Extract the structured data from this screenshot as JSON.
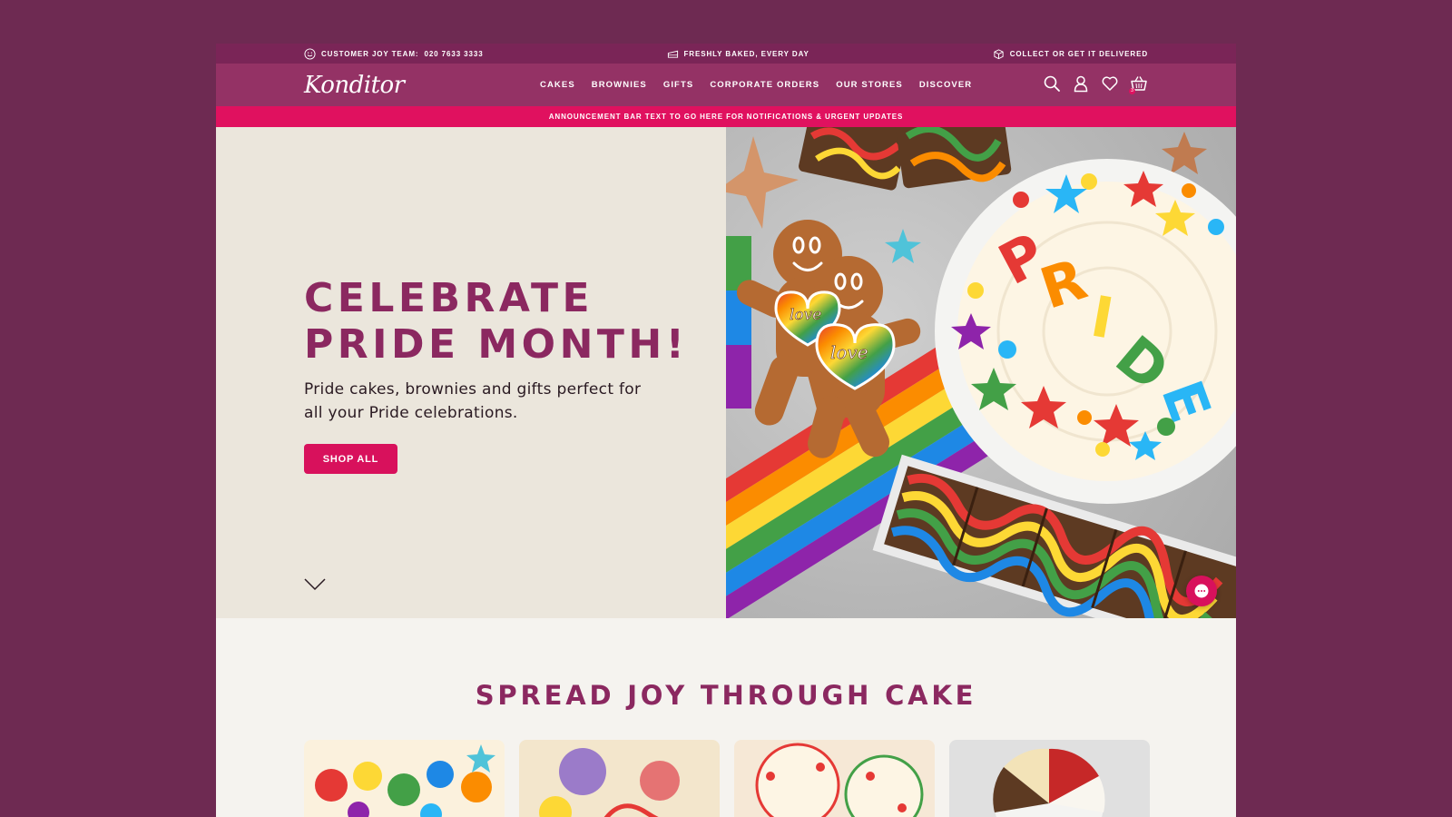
{
  "utility_bar": {
    "customer_team_label": "CUSTOMER JOY TEAM:",
    "phone": "020 7633 3333",
    "fresh_text": "FRESHLY BAKED, EVERY DAY",
    "delivery_text": "COLLECT OR GET IT DELIVERED",
    "icons": [
      "smile-icon",
      "cake-slice-icon",
      "box-icon"
    ]
  },
  "nav": {
    "logo_text": "Konditor",
    "items": [
      {
        "label": "CAKES"
      },
      {
        "label": "BROWNIES"
      },
      {
        "label": "GIFTS"
      },
      {
        "label": "CORPORATE ORDERS"
      },
      {
        "label": "OUR STORES"
      },
      {
        "label": "DISCOVER"
      }
    ],
    "icons": [
      "search-icon",
      "account-icon",
      "wishlist-heart-icon",
      "basket-icon"
    ],
    "cart_count": "3"
  },
  "announcement": {
    "text": "ANNOUNCEMENT BAR TEXT TO GO HERE FOR NOTIFICATIONS & URGENT UPDATES"
  },
  "hero": {
    "title": "CELEBRATE\nPRIDE MONTH!",
    "subtitle": "Pride cakes, brownies and gifts perfect for all your Pride celebrations.",
    "button_label": "SHOP ALL",
    "cake_text": "PRIDE",
    "cookie_text": "love"
  },
  "section": {
    "title": "SPREAD JOY THROUGH CAKE"
  },
  "colors": {
    "page_bg": "#6e2a52",
    "utility_bar": "#7a2557",
    "nav_bg": "#943265",
    "accent_pink": "#e0115f",
    "hero_left_bg": "#ebe6dc",
    "heading": "#8b2860"
  }
}
